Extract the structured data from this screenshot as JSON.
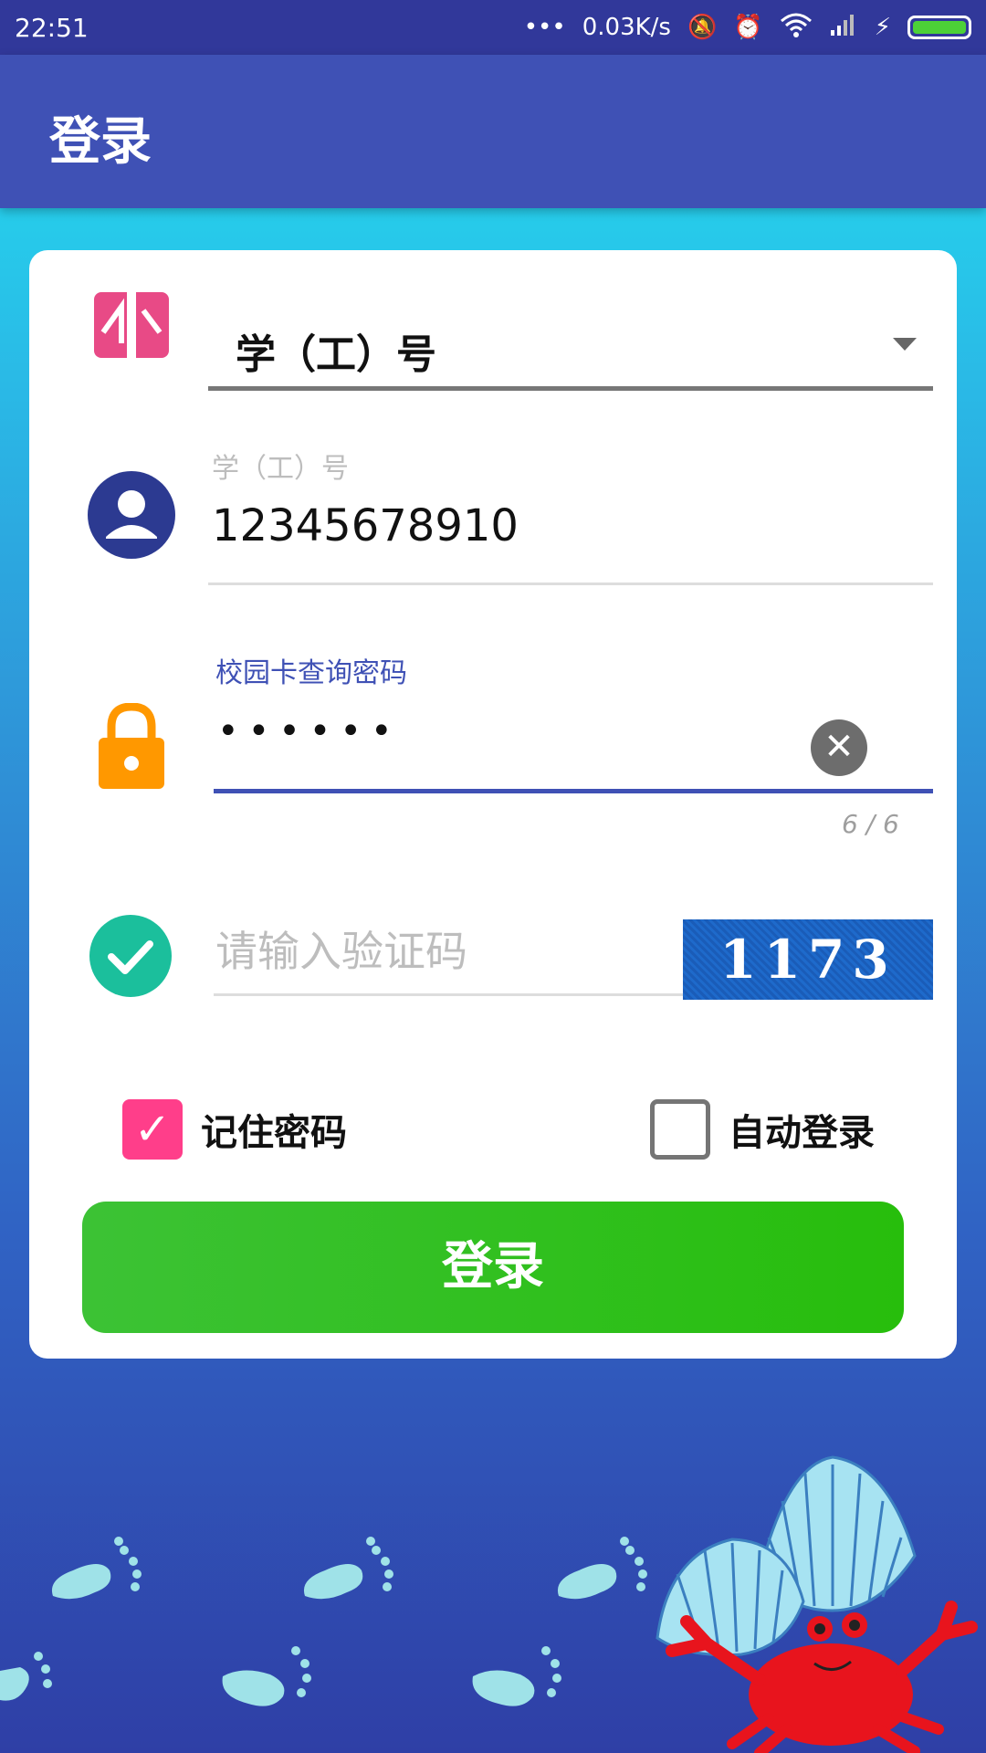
{
  "status_bar": {
    "time": "22:51",
    "network_speed": "0.03K/s",
    "icons": [
      "more-dots-icon",
      "mute-icon",
      "alarm-icon",
      "wifi-icon",
      "signal-icon",
      "charging-icon",
      "battery-icon"
    ]
  },
  "app_bar": {
    "title": "登录"
  },
  "form": {
    "user_type": {
      "value": "学（工）号",
      "icon": "user-type-icon"
    },
    "account": {
      "label": "学（工）号",
      "value": "12345678910",
      "icon": "person-icon"
    },
    "password": {
      "label": "校园卡查询密码",
      "value": "••••••",
      "counter": "6 / 6",
      "icon": "lock-icon"
    },
    "captcha": {
      "placeholder": "请输入验证码",
      "image_text": "1173",
      "icon": "check-circle-icon"
    },
    "remember_password": {
      "label": "记住密码",
      "checked": true
    },
    "auto_login": {
      "label": "自动登录",
      "checked": false
    },
    "login_button": "登录"
  },
  "colors": {
    "app_bar": "#3f51b5",
    "status_bar": "#31389a",
    "accent": "#3f51b5",
    "login_button": "#27be0c",
    "checkbox_checked": "#ff3e8a",
    "user_icon": "#2c3a91",
    "lock_icon": "#ff9800",
    "check_icon": "#1bbf9c"
  }
}
